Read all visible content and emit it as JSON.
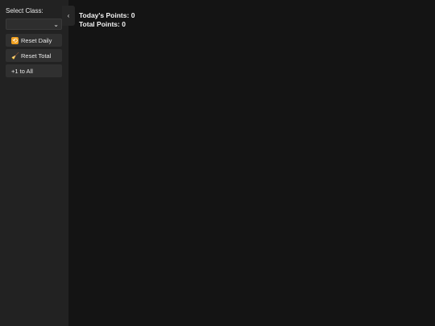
{
  "sidebar": {
    "select_label": "Select Class:",
    "class_select": {
      "selected_value": ""
    },
    "buttons": [
      {
        "label": "Reset Daily",
        "icon": "counterclockwise-arrows-icon"
      },
      {
        "label": "Reset Total",
        "icon": "broom-icon"
      },
      {
        "label": "+1 to All",
        "icon": ""
      }
    ],
    "collapse_toggle_icon": "chevron-left-icon"
  },
  "points": {
    "today_label": "Today's Points:",
    "today_value": "0",
    "total_label": "Total Points:",
    "total_value": "0"
  },
  "colors": {
    "background": "#141414",
    "sidebar": "#222222",
    "button": "#303030",
    "text": "#e6e6e6"
  }
}
